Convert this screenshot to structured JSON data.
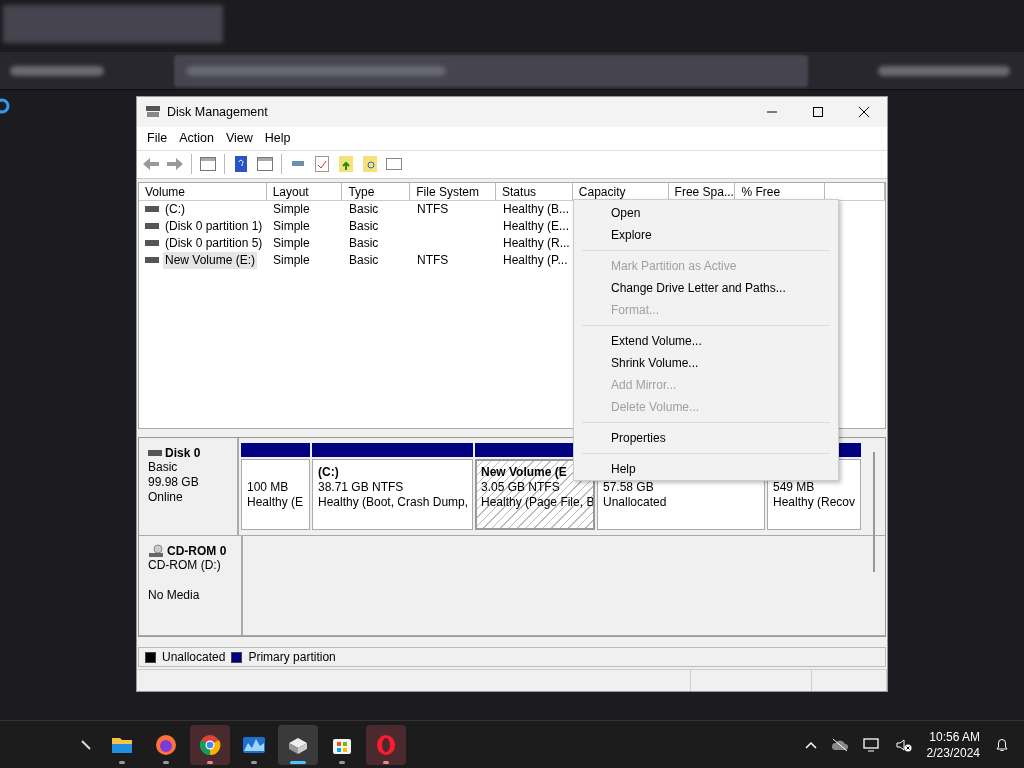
{
  "window": {
    "title": "Disk Management"
  },
  "menu_bar": [
    "File",
    "Action",
    "View",
    "Help"
  ],
  "volume_list": {
    "columns": [
      "Volume",
      "Layout",
      "Type",
      "File System",
      "Status",
      "Capacity",
      "Free Spa...",
      "% Free"
    ],
    "rows": [
      {
        "cells": [
          "(C:)",
          "Simple",
          "Basic",
          "NTFS",
          "Healthy (B..."
        ],
        "selected": false
      },
      {
        "cells": [
          "(Disk 0 partition 1)",
          "Simple",
          "Basic",
          "",
          "Healthy (E..."
        ],
        "selected": false
      },
      {
        "cells": [
          "(Disk 0 partition 5)",
          "Simple",
          "Basic",
          "",
          "Healthy (R..."
        ],
        "selected": false
      },
      {
        "cells": [
          "New Volume (E:)",
          "Simple",
          "Basic",
          "NTFS",
          "Healthy (P..."
        ],
        "selected": true
      }
    ]
  },
  "disks": [
    {
      "kind": "disk",
      "name": "Disk 0",
      "type": "Basic",
      "size": "99.98 GB",
      "status": "Online",
      "partitions": [
        {
          "kind": "primary",
          "selected": false,
          "line1": "100 MB",
          "line2": "Healthy (E"
        },
        {
          "kind": "primary",
          "selected": false,
          "name": "(C:)",
          "line1": "38.71 GB NTFS",
          "line2": "Healthy (Boot, Crash Dump,"
        },
        {
          "kind": "primary",
          "selected": true,
          "name": "New Volume  (E",
          "line1": "3.05 GB NTFS",
          "line2": "Healthy (Page File, B"
        },
        {
          "kind": "unallocated",
          "selected": false,
          "line1": "57.58 GB",
          "line2": "Unallocated"
        },
        {
          "kind": "primary",
          "selected": false,
          "line1": "549 MB",
          "line2": "Healthy (Recov"
        }
      ]
    },
    {
      "kind": "cdrom",
      "name": "CD-ROM 0",
      "type": "CD-ROM (D:)",
      "status": "No Media"
    }
  ],
  "legend": [
    {
      "label": "Unallocated",
      "color": "#000000"
    },
    {
      "label": "Primary partition",
      "color": "#000080"
    }
  ],
  "context_menu": {
    "groups": [
      {
        "items": [
          {
            "label": "Open",
            "disabled": false
          },
          {
            "label": "Explore",
            "disabled": false
          }
        ]
      },
      {
        "items": [
          {
            "label": "Mark Partition as Active",
            "disabled": true
          },
          {
            "label": "Change Drive Letter and Paths...",
            "disabled": false
          },
          {
            "label": "Format...",
            "disabled": true
          }
        ]
      },
      {
        "items": [
          {
            "label": "Extend Volume...",
            "disabled": false
          },
          {
            "label": "Shrink Volume...",
            "disabled": false
          },
          {
            "label": "Add Mirror...",
            "disabled": true
          },
          {
            "label": "Delete Volume...",
            "disabled": true
          }
        ]
      },
      {
        "items": [
          {
            "label": "Properties",
            "disabled": false
          }
        ]
      },
      {
        "items": [
          {
            "label": "Help",
            "disabled": false
          }
        ]
      }
    ]
  },
  "taskbar": {
    "apps": [
      {
        "kind": "folder",
        "selected": false,
        "alert": false
      },
      {
        "kind": "firefox",
        "selected": false,
        "alert": false
      },
      {
        "kind": "chrome",
        "selected": false,
        "alert": true
      },
      {
        "kind": "chart",
        "selected": false,
        "alert": false
      },
      {
        "kind": "disk",
        "selected": true,
        "alert": false
      },
      {
        "kind": "store",
        "selected": false,
        "alert": false
      },
      {
        "kind": "opera",
        "selected": false,
        "alert": true
      }
    ],
    "time": "10:56 AM",
    "date": "2/23/2024"
  }
}
